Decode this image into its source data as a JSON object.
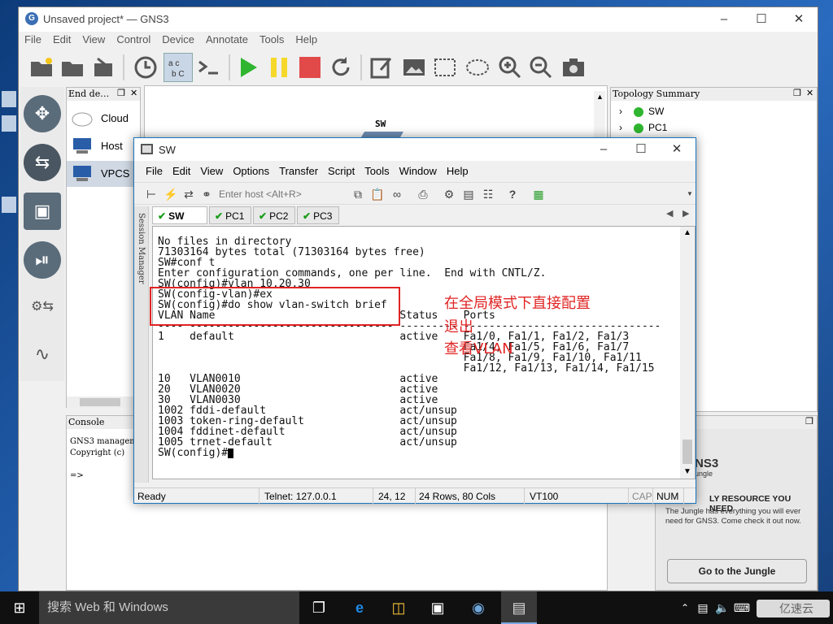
{
  "gns3": {
    "title": "Unsaved project* — GNS3",
    "menu": [
      "File",
      "Edit",
      "View",
      "Control",
      "Device",
      "Annotate",
      "Tools",
      "Help"
    ],
    "end_devices_title": "End de…",
    "devices": [
      "Cloud",
      "Host",
      "VPCS"
    ],
    "canvas_node": "SW",
    "topology_title": "Topology Summary",
    "topology_nodes": [
      "SW",
      "PC1"
    ],
    "console_title": "Console",
    "console_lines": [
      "GNS3 manageme",
      "Copyright (c)",
      "=>"
    ],
    "newsfeed_title": "ewsfeed",
    "news": {
      "brand": "NS3",
      "brand_sub": "ungle",
      "headline": "LY RESOURCE YOU NEED",
      "body": "The Jungle has everything you will ever need for GNS3. Come check it out now.",
      "button": "Go to the Jungle"
    }
  },
  "crt": {
    "title": "SW",
    "menu": [
      "File",
      "Edit",
      "View",
      "Options",
      "Transfer",
      "Script",
      "Tools",
      "Window",
      "Help"
    ],
    "host_placeholder": "Enter host <Alt+R>",
    "session_manager": "Session Manager",
    "tabs": [
      "SW",
      "PC1",
      "PC2",
      "PC3"
    ],
    "terminal_lines": [
      "No files in directory",
      "",
      "71303164 bytes total (71303164 bytes free)",
      "SW#conf t",
      "Enter configuration commands, one per line.  End with CNTL/Z.",
      "SW(config)#vlan 10,20,30",
      "SW(config-vlan)#ex",
      "SW(config)#do show vlan-switch brief",
      "",
      "VLAN Name                             Status    Ports",
      "---- -------------------------------- --------- -------------------------------",
      "1    default                          active    Fa1/0, Fa1/1, Fa1/2, Fa1/3",
      "                                                Fa1/4, Fa1/5, Fa1/6, Fa1/7",
      "                                                Fa1/8, Fa1/9, Fa1/10, Fa1/11",
      "                                                Fa1/12, Fa1/13, Fa1/14, Fa1/15",
      "10   VLAN0010                         active",
      "20   VLAN0020                         active",
      "30   VLAN0030                         active",
      "1002 fddi-default                     act/unsup",
      "1003 token-ring-default               act/unsup",
      "1004 fddinet-default                  act/unsup",
      "1005 trnet-default                    act/unsup",
      "SW(config)#"
    ],
    "status": {
      "ready": "Ready",
      "telnet": "Telnet: 127.0.0.1",
      "pos": "24,  12",
      "size": "24 Rows, 80 Cols",
      "emu": "VT100",
      "cap": "CAP",
      "num": "NUM"
    }
  },
  "annotations": [
    "在全局模式下直接配置",
    "退出",
    "查看VLAN"
  ],
  "taskbar": {
    "search": "搜索 Web 和 Windows",
    "watermark": "亿速云"
  },
  "colors": {
    "annotation": "#e02424",
    "status_ok": "#1a9d1a",
    "play": "#2fb52f",
    "stop": "#e24a4a"
  }
}
